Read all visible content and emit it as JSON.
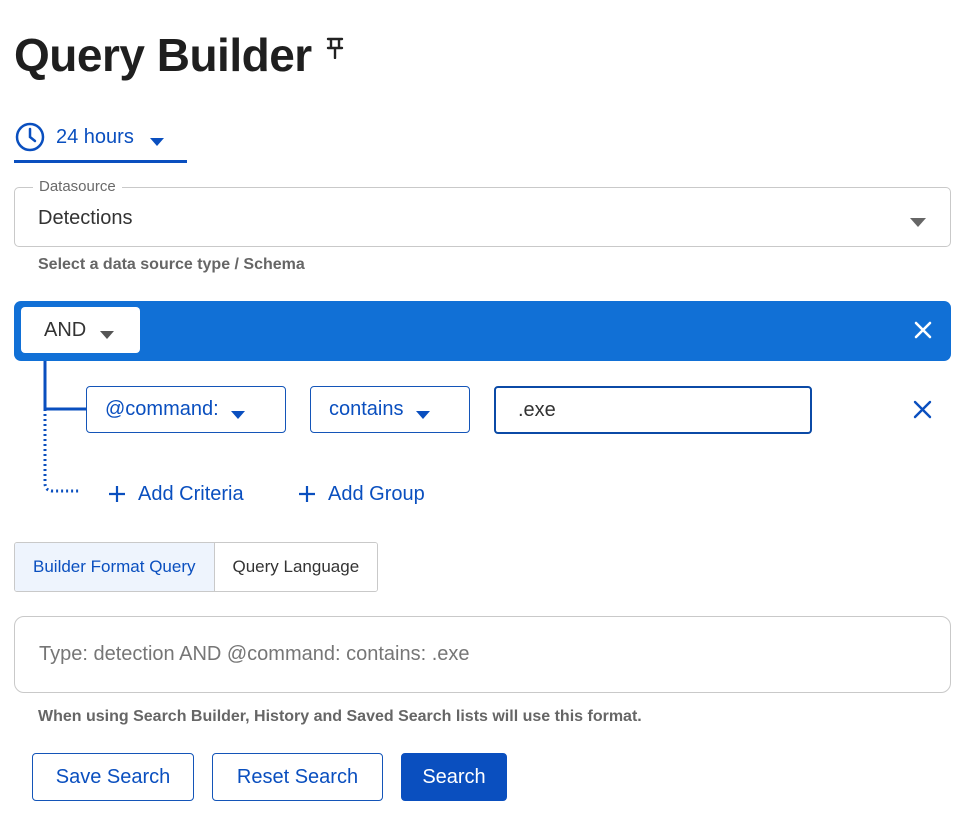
{
  "page": {
    "title": "Query Builder",
    "pin_icon": "pin-icon"
  },
  "time_range": {
    "label": "24 hours",
    "icon": "clock-icon"
  },
  "datasource": {
    "legend": "Datasource",
    "value": "Detections",
    "helper": "Select a data source type / Schema"
  },
  "group": {
    "operator": "AND"
  },
  "criteria": [
    {
      "field": "@command:",
      "operator": "contains",
      "value": ".exe"
    }
  ],
  "actions": {
    "add_criteria": "Add Criteria",
    "add_group": "Add Group"
  },
  "format_toggle": {
    "options": [
      "Builder Format Query",
      "Query Language"
    ],
    "selected": "Builder Format Query"
  },
  "query": {
    "text": "Type: detection AND @command: contains: .exe",
    "help": "When using Search Builder, History and Saved Search lists will use this format."
  },
  "buttons": {
    "save": "Save Search",
    "reset": "Reset Search",
    "search": "Search"
  },
  "colors": {
    "accent": "#0a4fbf",
    "group_bar": "#1170d6",
    "border": "#c9c9c9"
  }
}
